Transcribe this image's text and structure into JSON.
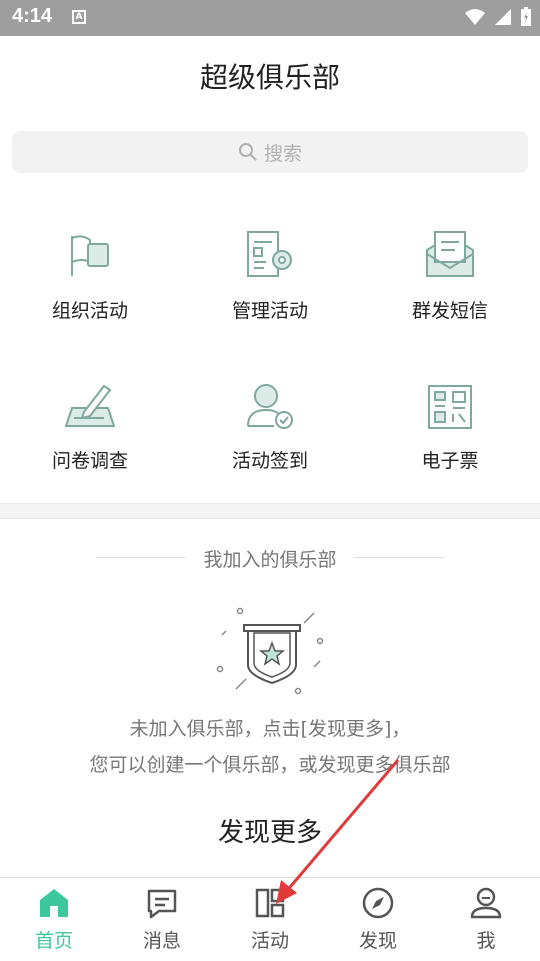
{
  "status": {
    "time": "4:14",
    "a_glyph": "A"
  },
  "header": {
    "title": "超级俱乐部"
  },
  "search": {
    "placeholder": "搜索"
  },
  "grid": [
    {
      "label": "组织活动",
      "icon": "flag-icon"
    },
    {
      "label": "管理活动",
      "icon": "document-gear-icon"
    },
    {
      "label": "群发短信",
      "icon": "mail-icon"
    },
    {
      "label": "问卷调查",
      "icon": "pencil-paper-icon"
    },
    {
      "label": "活动签到",
      "icon": "person-check-icon"
    },
    {
      "label": "电子票",
      "icon": "qrcode-icon"
    }
  ],
  "section": {
    "title": "我加入的俱乐部",
    "empty_line1": "未加入俱乐部，点击[发现更多]，",
    "empty_line2": "您可以创建一个俱乐部，或发现更多俱乐部",
    "discover_more": "发现更多"
  },
  "nav": [
    {
      "label": "首页",
      "icon": "home-icon",
      "active": true
    },
    {
      "label": "消息",
      "icon": "message-icon",
      "active": false
    },
    {
      "label": "活动",
      "icon": "activity-icon",
      "active": false
    },
    {
      "label": "发现",
      "icon": "compass-icon",
      "active": false
    },
    {
      "label": "我",
      "icon": "user-icon",
      "active": false
    }
  ],
  "colors": {
    "accent": "#3cc79c",
    "icon": "#7fa89e",
    "arrow": "#e03a3a"
  }
}
